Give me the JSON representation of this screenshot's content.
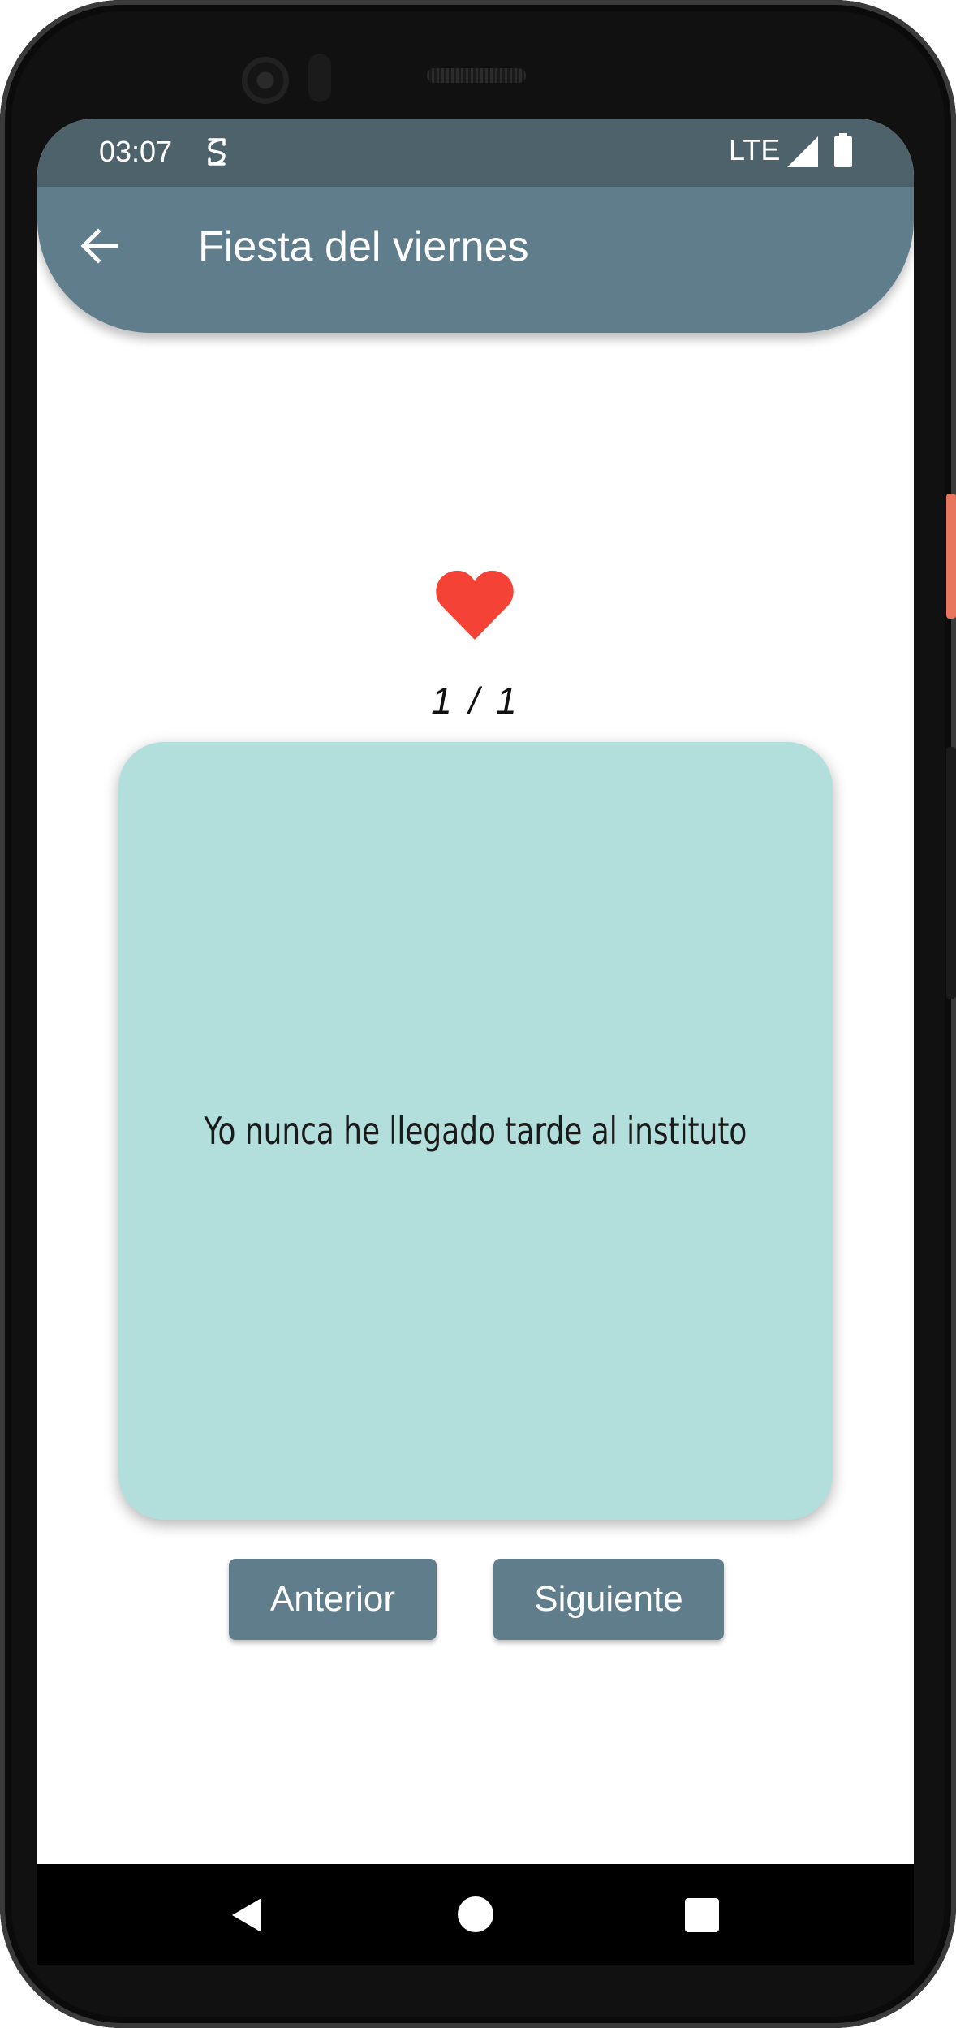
{
  "status_bar": {
    "time": "03:07",
    "network": "LTE",
    "icons": [
      "sim-icon",
      "signal-icon",
      "battery-icon"
    ]
  },
  "app_bar": {
    "title": "Fiesta del viernes",
    "back_icon": "arrow-back-icon"
  },
  "favorite": {
    "icon": "heart-icon",
    "color": "#f44336"
  },
  "counter": {
    "text": "1 / 1"
  },
  "card": {
    "text": "Yo nunca he llegado tarde al instituto",
    "color": "#b2dfdb"
  },
  "buttons": {
    "previous_label": "Anterior",
    "next_label": "Siguiente",
    "color": "#607d8b"
  },
  "nav_bar": {
    "icons": [
      "nav-back-icon",
      "nav-home-icon",
      "nav-recents-icon"
    ]
  },
  "theme": {
    "primary": "#607d8b",
    "status_bar": "#4e626c",
    "accent": "#f44336"
  }
}
